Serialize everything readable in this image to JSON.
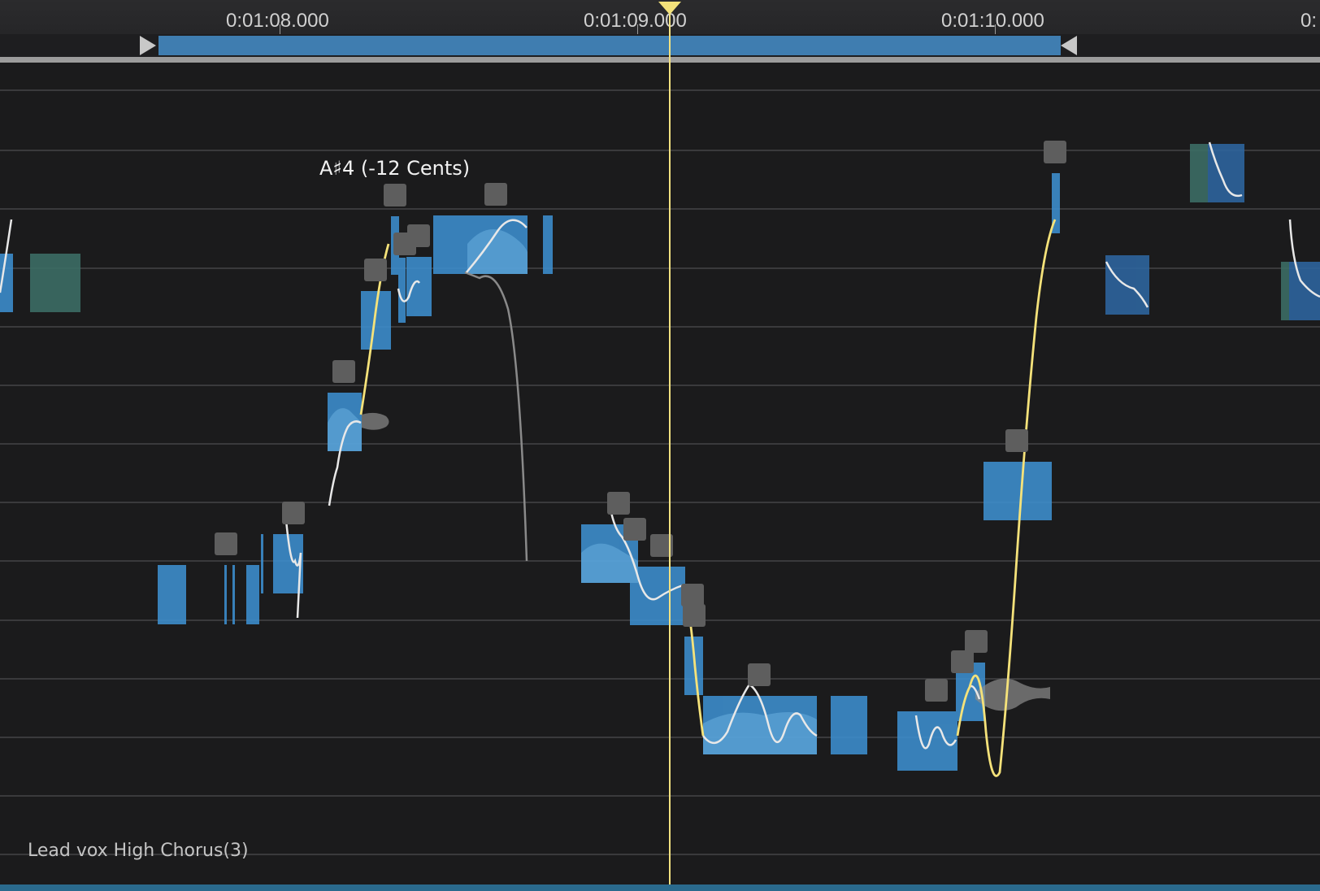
{
  "timeline": {
    "ticks": [
      {
        "label": "0:01:08.000"
      },
      {
        "label": "0:01:09.000"
      },
      {
        "label": "0:01:10.000"
      },
      {
        "label": "0:"
      }
    ]
  },
  "editor": {
    "note_tooltip": "A♯4 (-12 Cents)",
    "track_name": "Lead vox High Chorus(3)"
  },
  "colors": {
    "background": "#1b1b1c",
    "note_blob": "#3d8fcf",
    "selected_pitch_curve": "#f5e27a",
    "pitch_curve": "#e8e8e8",
    "inactive_pitch_curve": "#8a8a8a",
    "playhead": "#f2e180",
    "loop_range": "#3f7db0",
    "handle": "#5e5e5e"
  }
}
